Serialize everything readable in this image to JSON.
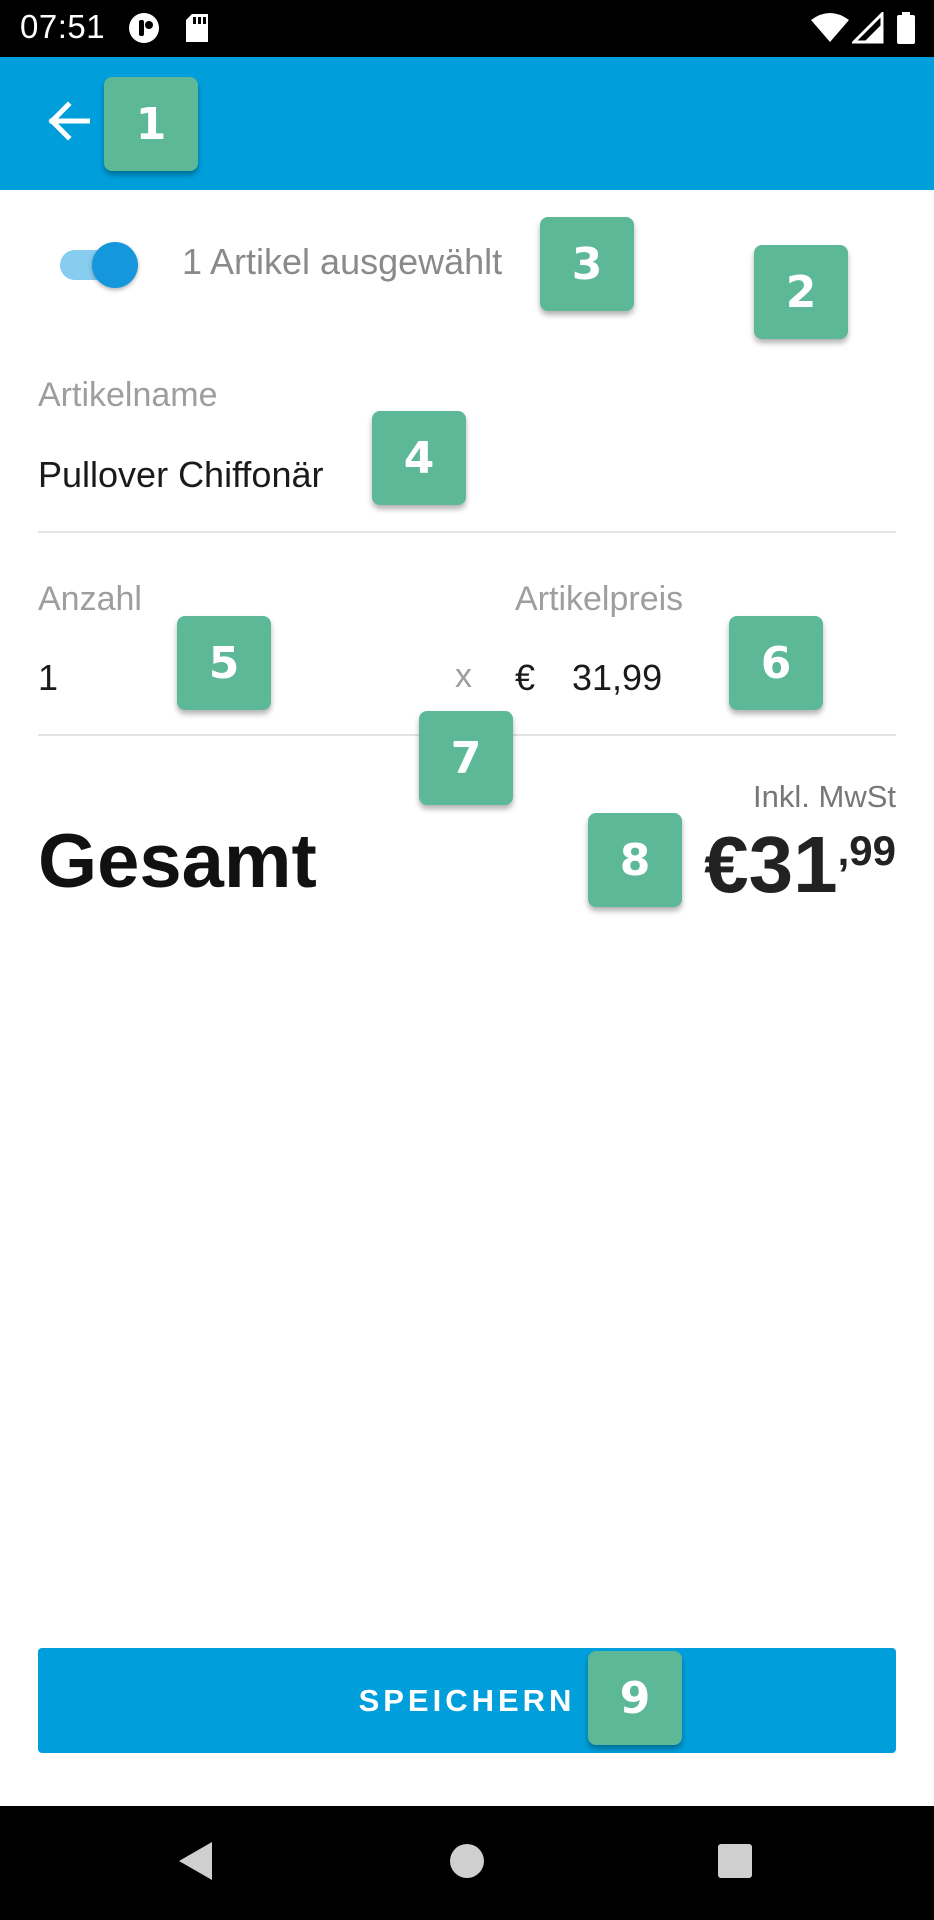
{
  "status_bar": {
    "time": "07:51",
    "icons": [
      "notification-icon",
      "sd-card-icon",
      "wifi-icon",
      "signal-icon",
      "battery-icon"
    ]
  },
  "app_bar": {
    "back_icon": "arrow-left-icon",
    "color": "#009fdb"
  },
  "selection": {
    "toggle_on": true,
    "label": "1 Artikel ausgewählt"
  },
  "item": {
    "name_label": "Artikelname",
    "name_value": "Pullover Chiffonär"
  },
  "quantity": {
    "label": "Anzahl",
    "value": "1"
  },
  "multiply": "x",
  "price": {
    "label": "Artikelpreis",
    "currency": "€",
    "value": "31,99"
  },
  "total": {
    "tax_note": "Inkl. MwSt",
    "label": "Gesamt",
    "amount_main": "€31",
    "amount_cents": ",99"
  },
  "save_button": {
    "label": "SPEICHERN",
    "color": "#009fdb"
  },
  "badges": [
    "1",
    "2",
    "3",
    "4",
    "5",
    "6",
    "7",
    "8",
    "9"
  ],
  "nav_bar": {
    "icons": [
      "back-triangle-icon",
      "home-circle-icon",
      "recents-square-icon"
    ]
  }
}
